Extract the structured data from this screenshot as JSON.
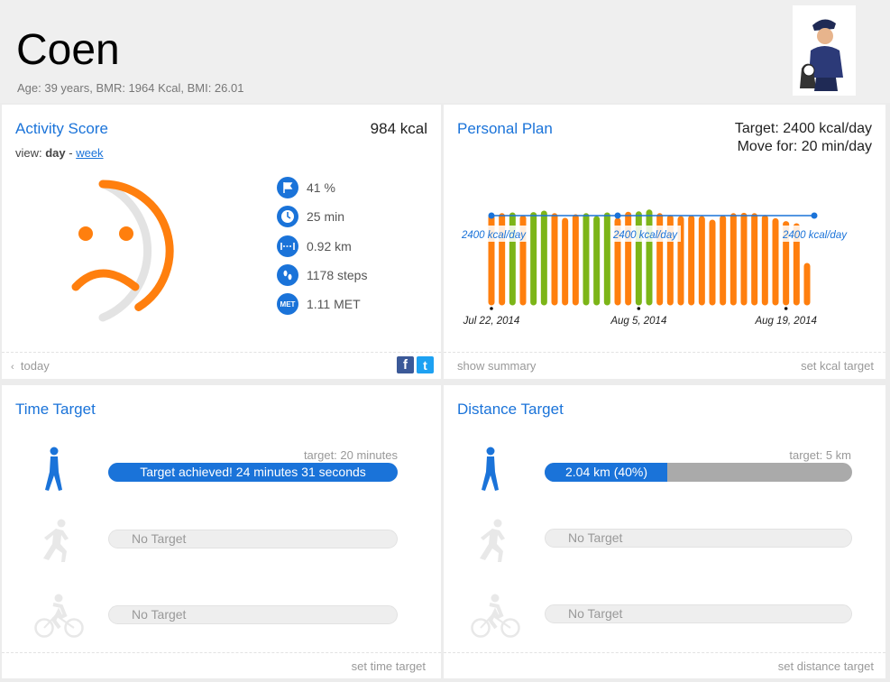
{
  "user": {
    "name": "Coen",
    "stats": "Age:  39 years,   BMR:  1964 Kcal,   BMI:  26.01"
  },
  "activity": {
    "title": "Activity Score",
    "kcal": "984 kcal",
    "view_prefix": "view: ",
    "view_day": "day",
    "view_sep": " - ",
    "view_week": "week",
    "score_fraction": 0.41,
    "stats": [
      {
        "icon": "flag-icon",
        "text": "41 %"
      },
      {
        "icon": "clock-icon",
        "text": "25 min"
      },
      {
        "icon": "distance-icon",
        "text": "0.92 km"
      },
      {
        "icon": "footsteps-icon",
        "text": "1178 steps"
      },
      {
        "icon": "met-icon",
        "icon_text": "MET",
        "text": "1.11 MET"
      }
    ],
    "footer_left": "today",
    "share_facebook": "f",
    "share_twitter": "t"
  },
  "plan": {
    "title": "Personal Plan",
    "target": "Target: 2400 kcal/day",
    "move": "Move for: 20 min/day",
    "footer_left": "show summary",
    "footer_right": "set kcal target",
    "colors": {
      "below": "#ff7f0e",
      "above": "#7cb518",
      "line": "#1a73d9"
    }
  },
  "chart_data": {
    "type": "bar",
    "target_label": "2400 kcal/day",
    "target_value": 2400,
    "ylim": [
      0,
      3000
    ],
    "x_tick_labels": [
      "Jul 22, 2014",
      "Aug 5, 2014",
      "Aug 19, 2014"
    ],
    "values": [
      2350,
      2380,
      2400,
      2320,
      2410,
      2450,
      2380,
      2250,
      2350,
      2380,
      2300,
      2400,
      2250,
      2420,
      2430,
      2480,
      2380,
      2330,
      2300,
      2320,
      2300,
      2200,
      2320,
      2380,
      2390,
      2380,
      2330,
      2240,
      2160,
      2100,
      1000
    ],
    "over_target": [
      false,
      false,
      true,
      false,
      true,
      true,
      false,
      false,
      false,
      true,
      true,
      true,
      false,
      false,
      true,
      true,
      false,
      false,
      false,
      false,
      false,
      false,
      false,
      false,
      false,
      false,
      false,
      false,
      false,
      false,
      false
    ]
  },
  "time_target": {
    "title": "Time Target",
    "caption": "target: 20 minutes",
    "achieved_text": "Target achieved! 24 minutes 31 seconds",
    "progress": 1.0,
    "no_target_1": "No Target",
    "no_target_2": "No Target",
    "footer_right": "set time target"
  },
  "distance_target": {
    "title": "Distance Target",
    "caption": "target: 5 km",
    "progress_text": "2.04 km (40%)",
    "progress": 0.4,
    "no_target_1": "No Target",
    "no_target_2": "No Target",
    "footer_right": "set distance target"
  }
}
